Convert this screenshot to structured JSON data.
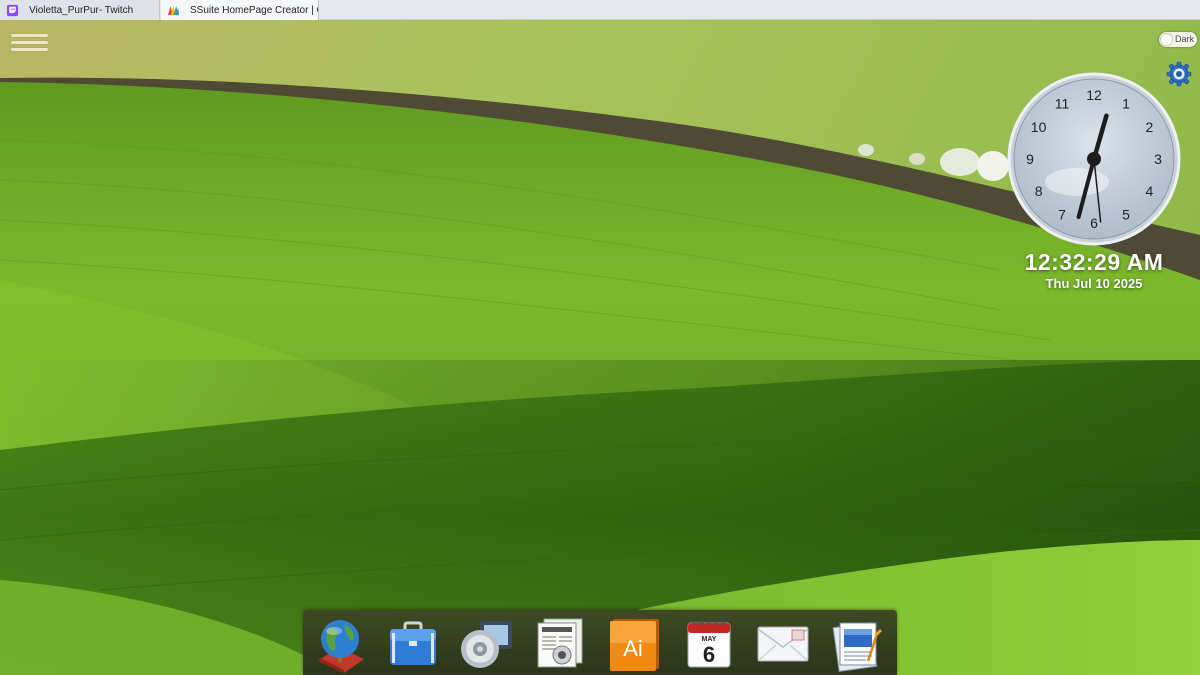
{
  "browser": {
    "tabs": [
      {
        "title": "Violetta_PurPur- Twitch",
        "icon": "twitch-icon",
        "active": false
      },
      {
        "title": "SSuite HomePage Creator | Cr",
        "icon": "ssuite-icon",
        "active": true
      }
    ]
  },
  "desktop": {
    "wallpaper": "green-rolling-hills",
    "menu_icon": "hamburger-menu-icon",
    "dark_toggle_label": "Dark",
    "settings_icon": "gear-icon"
  },
  "clock": {
    "time_text": "12:32:29 AM",
    "date_text": "Thu Jul 10 2025",
    "hour": 0,
    "minute": 32,
    "second": 29,
    "numerals": [
      "12",
      "1",
      "2",
      "3",
      "4",
      "5",
      "6",
      "7",
      "8",
      "9",
      "10",
      "11"
    ]
  },
  "dock": {
    "items": [
      {
        "name": "web-browser",
        "icon": "globe-icon"
      },
      {
        "name": "portfolio",
        "icon": "briefcase-icon"
      },
      {
        "name": "media-player",
        "icon": "speaker-icon"
      },
      {
        "name": "news-reader",
        "icon": "newspaper-icon"
      },
      {
        "name": "illustrator",
        "icon": "ai-app-icon",
        "label": "Ai"
      },
      {
        "name": "calendar",
        "icon": "calendar-icon",
        "month": "MAY",
        "day": "6"
      },
      {
        "name": "mail",
        "icon": "mail-icon"
      },
      {
        "name": "notes",
        "icon": "notepad-icon"
      }
    ]
  },
  "colors": {
    "sky_field": "#9ec25a",
    "dirt_band": "#4f4a33",
    "grass_light": "#8cc43a",
    "grass_dark": "#3f7a18",
    "dock_bg": "#2c3519"
  }
}
